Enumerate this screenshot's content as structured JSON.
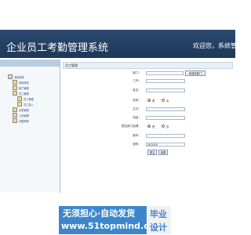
{
  "header": {
    "app_title": "企业员工考勤管理系统",
    "welcome": "欢迎您，系统管理员"
  },
  "sidebar": {
    "items": [
      {
        "label": "系统菜单"
      },
      {
        "label": "密码修改"
      },
      {
        "label": "部门管理"
      },
      {
        "label": "员工管理"
      },
      {
        "label": "员工管理"
      },
      {
        "label": "员工录入"
      },
      {
        "label": "出勤管理"
      },
      {
        "label": "工资管理"
      },
      {
        "label": "请假审核"
      }
    ]
  },
  "breadcrumb": {
    "label": "员工管理"
  },
  "form": {
    "department_label": "部门：",
    "department_select_button": "请选择部门",
    "employee_id_label": "工号：",
    "name_label": "姓名：",
    "gender_label": "性别：",
    "gender_male": "男",
    "gender_female": "女",
    "birthday_label": "生日：",
    "phone_label": "电话：",
    "is_manager_label": "是否部门经理：",
    "yes": "是",
    "no": "否",
    "account_label": "账号：",
    "password_label": "密码：",
    "password_value": "000000",
    "submit_label": "提交",
    "reset_label": "重置"
  },
  "ad": {
    "line1": "无须担心·自动发货",
    "line2": "www.51topmind.com",
    "badge1": "毕业",
    "badge2": "设计"
  },
  "colors": {
    "header": "#1d3858",
    "accent": "#3e86cc"
  }
}
